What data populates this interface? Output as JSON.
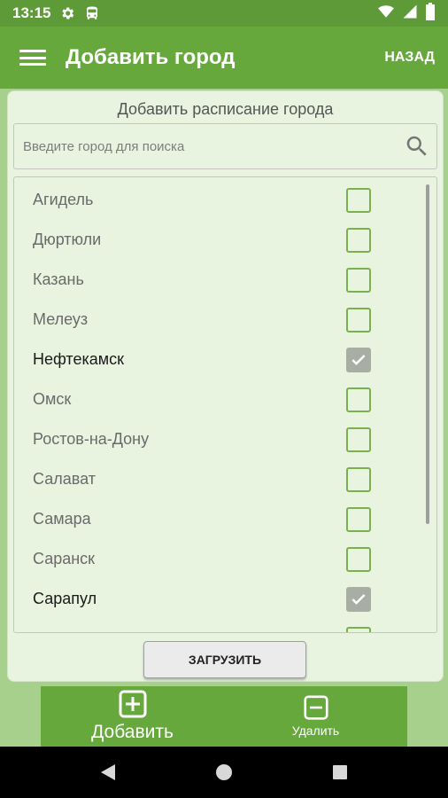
{
  "status_bar": {
    "time": "13:15",
    "icons": [
      "gear-icon",
      "bus-icon",
      "wifi-icon",
      "signal-icon",
      "battery-icon"
    ]
  },
  "app_bar": {
    "menu_icon": "hamburger-icon",
    "title": "Добавить город",
    "back_label": "НАЗАД"
  },
  "card": {
    "title": "Добавить расписание города",
    "search": {
      "placeholder": "Введите город для поиска",
      "value": "",
      "icon": "search-icon"
    },
    "cities": [
      {
        "name": "Агидель",
        "checked": false
      },
      {
        "name": "Дюртюли",
        "checked": false
      },
      {
        "name": "Казань",
        "checked": false
      },
      {
        "name": "Мелеуз",
        "checked": false
      },
      {
        "name": "Нефтекамск",
        "checked": true
      },
      {
        "name": "Омск",
        "checked": false
      },
      {
        "name": "Ростов-на-Дону",
        "checked": false
      },
      {
        "name": "Салават",
        "checked": false
      },
      {
        "name": "Самара",
        "checked": false
      },
      {
        "name": "Саранск",
        "checked": false
      },
      {
        "name": "Сарапул",
        "checked": true
      }
    ],
    "load_button": "ЗАГРУЗИТЬ"
  },
  "bottom_nav": {
    "add": {
      "label": "Добавить",
      "icon": "plus-box-icon"
    },
    "remove": {
      "label": "Удалить",
      "icon": "minus-box-icon"
    }
  },
  "system_nav": {
    "icons": [
      "back-icon",
      "home-icon",
      "recents-icon"
    ]
  },
  "colors": {
    "primary": "#67a83d",
    "status": "#5e9a37",
    "background": "#a8d08d",
    "card": "#e8f4e0",
    "checkbox_border": "#7bb04f",
    "checkbox_checked": "#a8aea4"
  }
}
